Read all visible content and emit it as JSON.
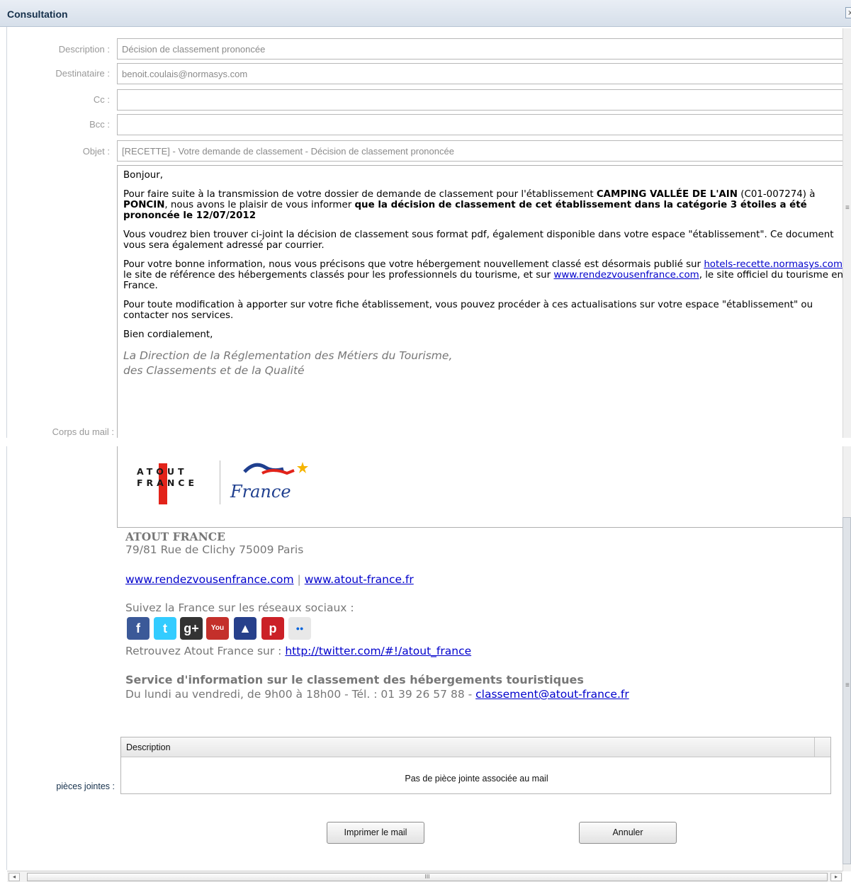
{
  "window": {
    "title": "Consultation",
    "close_glyph": "x"
  },
  "fields": {
    "description": {
      "label": "Description :",
      "value": "Décision de classement prononcée"
    },
    "destinataire": {
      "label": "Destinataire :",
      "value": "benoit.coulais@normasys.com"
    },
    "cc": {
      "label": "Cc :",
      "value": ""
    },
    "bcc": {
      "label": "Bcc :",
      "value": ""
    },
    "objet": {
      "label": "Objet :",
      "value": "[RECETTE] - Votre demande de classement - Décision de classement prononcée"
    },
    "corps": {
      "label": "Corps du mail :"
    }
  },
  "mail": {
    "greeting": "Bonjour,",
    "p1_a": "Pour faire suite à la transmission de votre dossier de demande de classement pour l'établissement ",
    "p1_establishment": "CAMPING VALLÉE DE L'AIN",
    "p1_b": " (C01-007274) à ",
    "p1_city": "PONCIN",
    "p1_c": ", nous avons le plaisir de vous informer ",
    "p1_bold": "que la décision de classement de cet établissement dans la catégorie 3 étoiles a été prononcée le 12/07/2012",
    "p2": "Vous voudrez bien trouver ci-joint la décision de classement sous format pdf, également disponible dans votre espace \"établissement\". Ce document vous sera également adressé par courrier.",
    "p3_a": "Pour votre bonne information, nous vous précisons que votre hébergement nouvellement classé est désormais publié sur ",
    "p3_link1": "hotels-recette.normasys.com",
    "p3_b": ", le site de référence des hébergements classés pour les professionnels du tourisme, et sur ",
    "p3_link2": "www.rendezvousenfrance.com",
    "p3_c": ", le site officiel du tourisme en France.",
    "p4": "Pour toute modification à apporter sur votre fiche établissement, vous pouvez procéder à ces actualisations sur votre espace \"établissement\" ou contacter nos services.",
    "closing": "Bien cordialement,",
    "sig_line1": "La Direction de la Réglementation des Métiers du Tourisme,",
    "sig_line2": "des Classements et de la Qualité"
  },
  "signature": {
    "logo_atout_line1": "ATOUT",
    "logo_atout_line2": "FRANCE",
    "logo_france": "France",
    "org": "ATOUT FRANCE",
    "address": "79/81 Rue de Clichy 75009 Paris",
    "link1": "www.rendezvousenfrance.com",
    "link_sep": "|",
    "link2": "www.atout-france.fr",
    "social_intro": "Suivez la France sur les réseaux sociaux :",
    "social_icons": [
      "facebook-icon",
      "twitter-icon",
      "google-plus-icon",
      "youtube-icon",
      "eiffel-tower-icon",
      "pinterest-icon",
      "flickr-icon"
    ],
    "twitter_prefix": "Retrouvez Atout France sur : ",
    "twitter_link": "http://twitter.com/#!/atout_france",
    "service_title": "Service d'information sur le classement des hébergements touristiques",
    "service_hours": "Du lundi au vendredi, de 9h00 à 18h00 - Tél. : 01 39 26 57 88 - ",
    "service_email": "classement@atout-france.fr"
  },
  "attachments": {
    "label": "pièces jointes :",
    "column": "Description",
    "empty": "Pas de pièce jointe associée au mail"
  },
  "buttons": {
    "print": "Imprimer le mail",
    "cancel": "Annuler"
  },
  "scrollbar": {
    "grip": "III",
    "left_arrow": "◂",
    "right_arrow": "▸"
  },
  "colors": {
    "link": "#0000cc",
    "label": "#999999",
    "title": "#15304b"
  }
}
